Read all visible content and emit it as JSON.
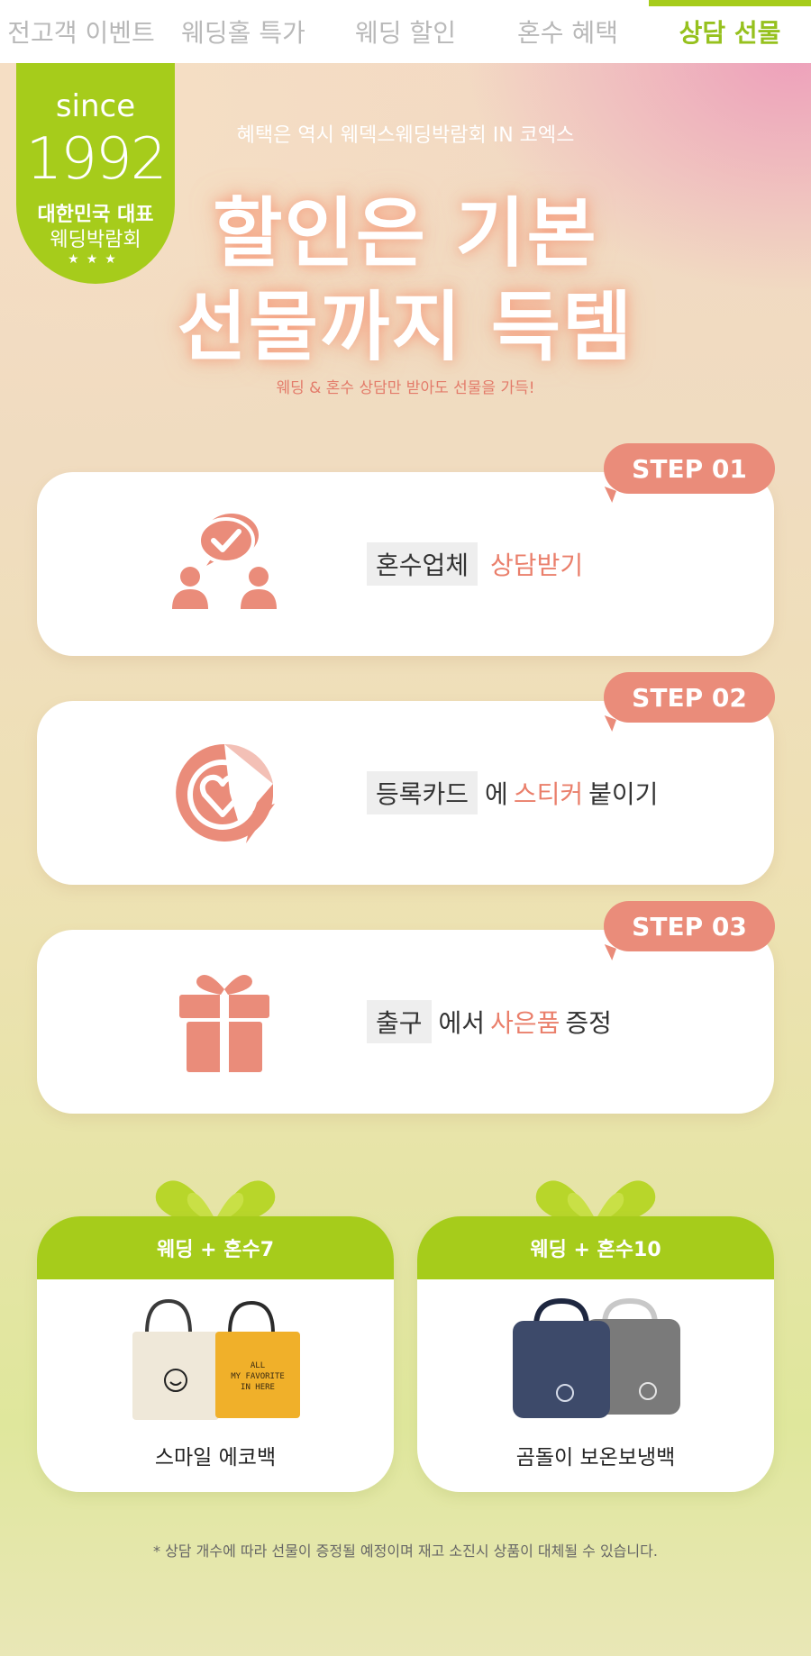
{
  "nav": {
    "tabs": [
      {
        "label": "전고객 이벤트",
        "active": false
      },
      {
        "label": "웨딩홀 특가",
        "active": false
      },
      {
        "label": "웨딩 할인",
        "active": false
      },
      {
        "label": "혼수 혜택",
        "active": false
      },
      {
        "label": "상담 선물",
        "active": true
      }
    ]
  },
  "badge": {
    "since": "since",
    "year": "1992",
    "line1": "대한민국 대표",
    "line2": "웨딩박람회",
    "stars": "★★★"
  },
  "hero": {
    "eyebrow": "혜택은 역시 웨덱스웨딩박람회 IN 코엑스",
    "line1": "할인은 기본",
    "line2": "선물까지 득템",
    "subline": "웨딩 & 혼수 상담만 받아도 선물을 가득!"
  },
  "steps": [
    {
      "tag": "STEP 01",
      "icon": "consultation-chat-icon",
      "box": "혼수업체",
      "accent": "상담받기",
      "after": ""
    },
    {
      "tag": "STEP 02",
      "icon": "heart-sticker-icon",
      "box": "등록카드",
      "mid": "에",
      "accent": "스티커",
      "after": "붙이기"
    },
    {
      "tag": "STEP 03",
      "icon": "gift-box-icon",
      "box": "출구",
      "mid": "에서",
      "accent": "사은품",
      "after": "증정"
    }
  ],
  "gifts": [
    {
      "header": "웨딩 + 혼수7",
      "name": "스마일 에코백",
      "icon": "eco-bag-image"
    },
    {
      "header": "웨딩 + 혼수10",
      "name": "곰돌이 보온보냉백",
      "icon": "cooler-bag-image"
    }
  ],
  "footnote": "* 상담 개수에 따라 선물이 증정될 예정이며 재고 소진시 상품이 대체될 수 있습니다.",
  "colors": {
    "accent_green": "#a6cc1b",
    "accent_coral": "#ea8c7a"
  }
}
